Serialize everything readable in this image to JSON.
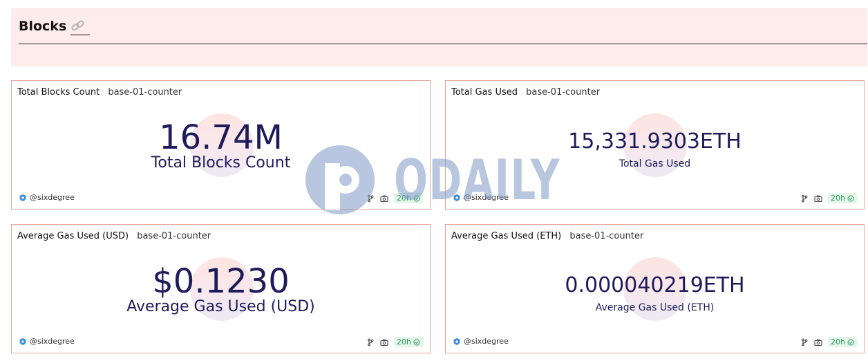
{
  "header": {
    "title": "Blocks",
    "link_icon": "link-icon"
  },
  "cards": [
    {
      "title": "Total Blocks Count",
      "subtitle": "base-01-counter",
      "value": "16.74M",
      "caption": "Total Blocks Count",
      "author": "@sixdegree",
      "age": "20h"
    },
    {
      "title": "Total Gas Used",
      "subtitle": "base-01-counter",
      "value": "15,331.9303ETH",
      "caption": "Total Gas Used",
      "author": "@sixdegree",
      "age": "20h"
    },
    {
      "title": "Average Gas Used (USD)",
      "subtitle": "base-01-counter",
      "value": "$0.1230",
      "caption": "Average Gas Used (USD)",
      "author": "@sixdegree",
      "age": "20h"
    },
    {
      "title": "Average Gas Used (ETH)",
      "subtitle": "base-01-counter",
      "value": "0.000040219ETH",
      "caption": "Average Gas Used (ETH)",
      "author": "@sixdegree",
      "age": "20h"
    }
  ],
  "watermark": {
    "text": "ODAILY"
  },
  "colors": {
    "value_text": "#1e1b5b",
    "card_border": "#e7a595",
    "header_bg": "#fdeceb",
    "badge_bg": "#e3f6ea",
    "badge_text": "#2f9a5a"
  },
  "icons": {
    "author": "shield-icon",
    "fork": "fork-icon",
    "snapshot": "camera-icon",
    "fresh": "check-circle-icon"
  }
}
